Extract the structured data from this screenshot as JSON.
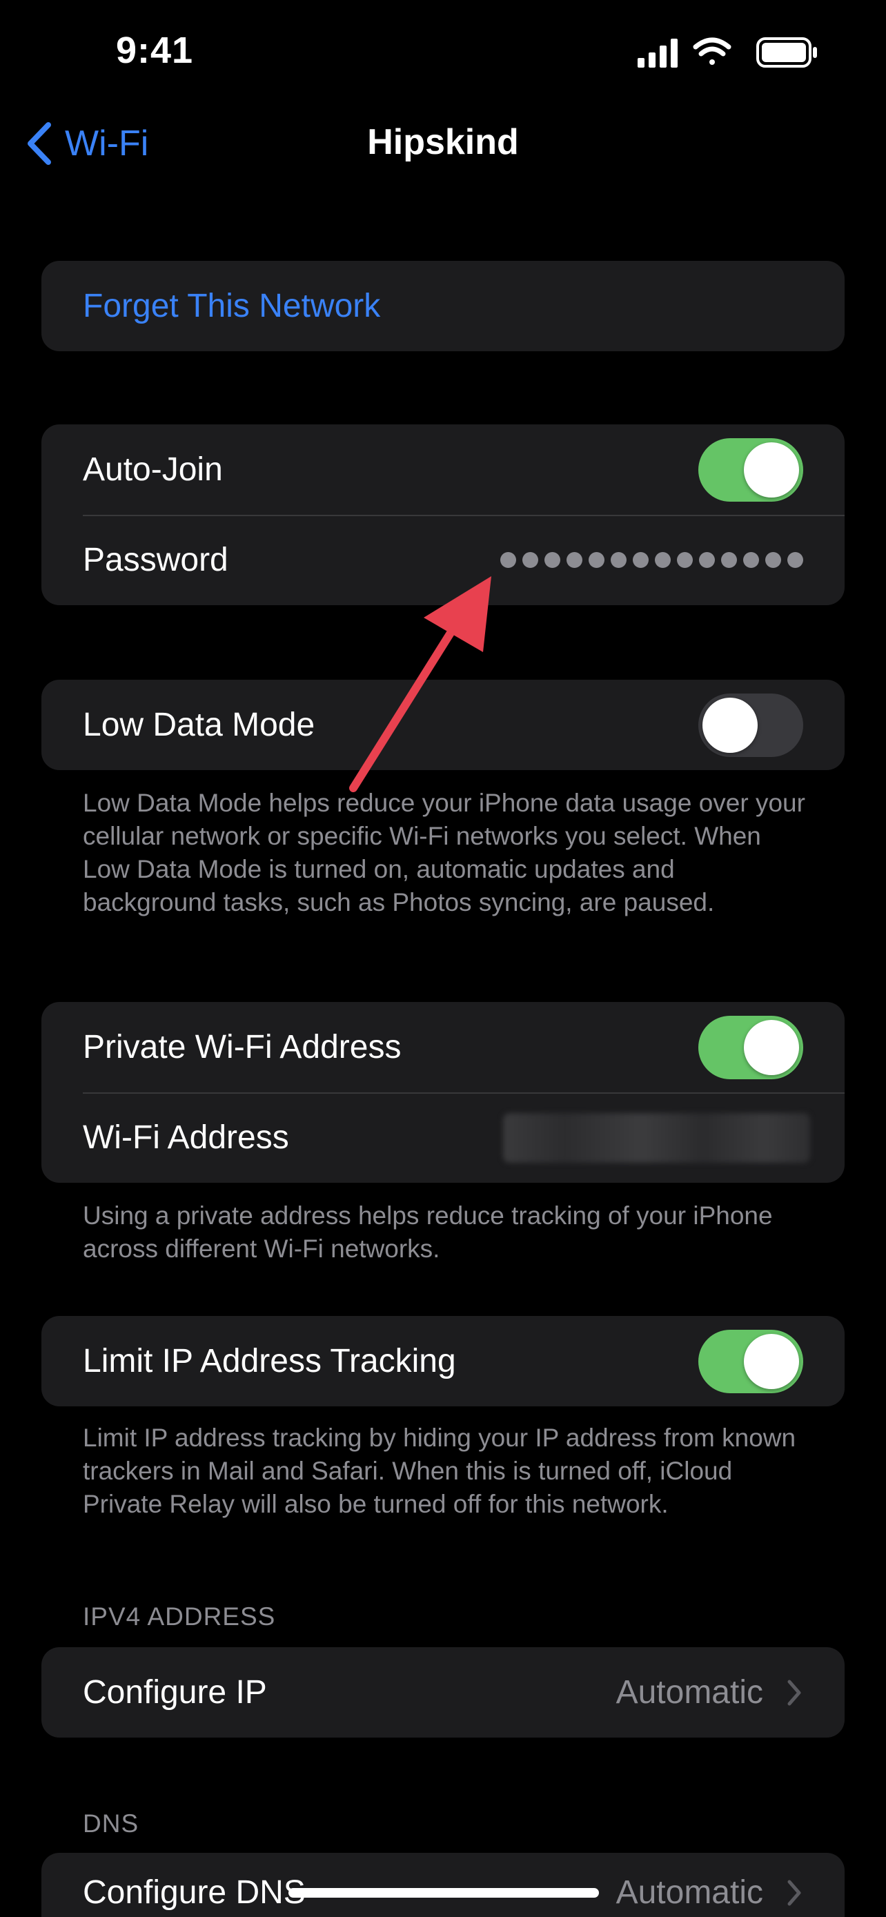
{
  "status_bar": {
    "time": "9:41",
    "icons": [
      "cellular-signal-icon",
      "wifi-icon",
      "battery-icon"
    ]
  },
  "nav": {
    "back_label": "Wi-Fi",
    "title": "Hipskind"
  },
  "forget": {
    "label": "Forget This Network"
  },
  "group_join": {
    "auto_join_label": "Auto-Join",
    "auto_join_on": true,
    "password_label": "Password",
    "password_dots": 14
  },
  "low_data": {
    "label": "Low Data Mode",
    "on": false,
    "footnote": "Low Data Mode helps reduce your iPhone data usage over your cellular network or specific Wi-Fi networks you select. When Low Data Mode is turned on, automatic updates and background tasks, such as Photos syncing, are paused."
  },
  "private_addr": {
    "label": "Private Wi-Fi Address",
    "on": true,
    "address_label": "Wi-Fi Address",
    "footnote": "Using a private address helps reduce tracking of your iPhone across different Wi-Fi networks."
  },
  "limit_ip": {
    "label": "Limit IP Address Tracking",
    "on": true,
    "footnote": "Limit IP address tracking by hiding your IP address from known trackers in Mail and Safari. When this is turned off, iCloud Private Relay will also be turned off for this network."
  },
  "ipv4": {
    "header": "IPV4 ADDRESS",
    "configure_label": "Configure IP",
    "configure_value": "Automatic"
  },
  "dns": {
    "header": "DNS",
    "configure_label": "Configure DNS",
    "configure_value": "Automatic"
  },
  "colors": {
    "accent": "#3a82f7",
    "toggle_on": "#65c466",
    "annotation_arrow": "#e8414f"
  }
}
